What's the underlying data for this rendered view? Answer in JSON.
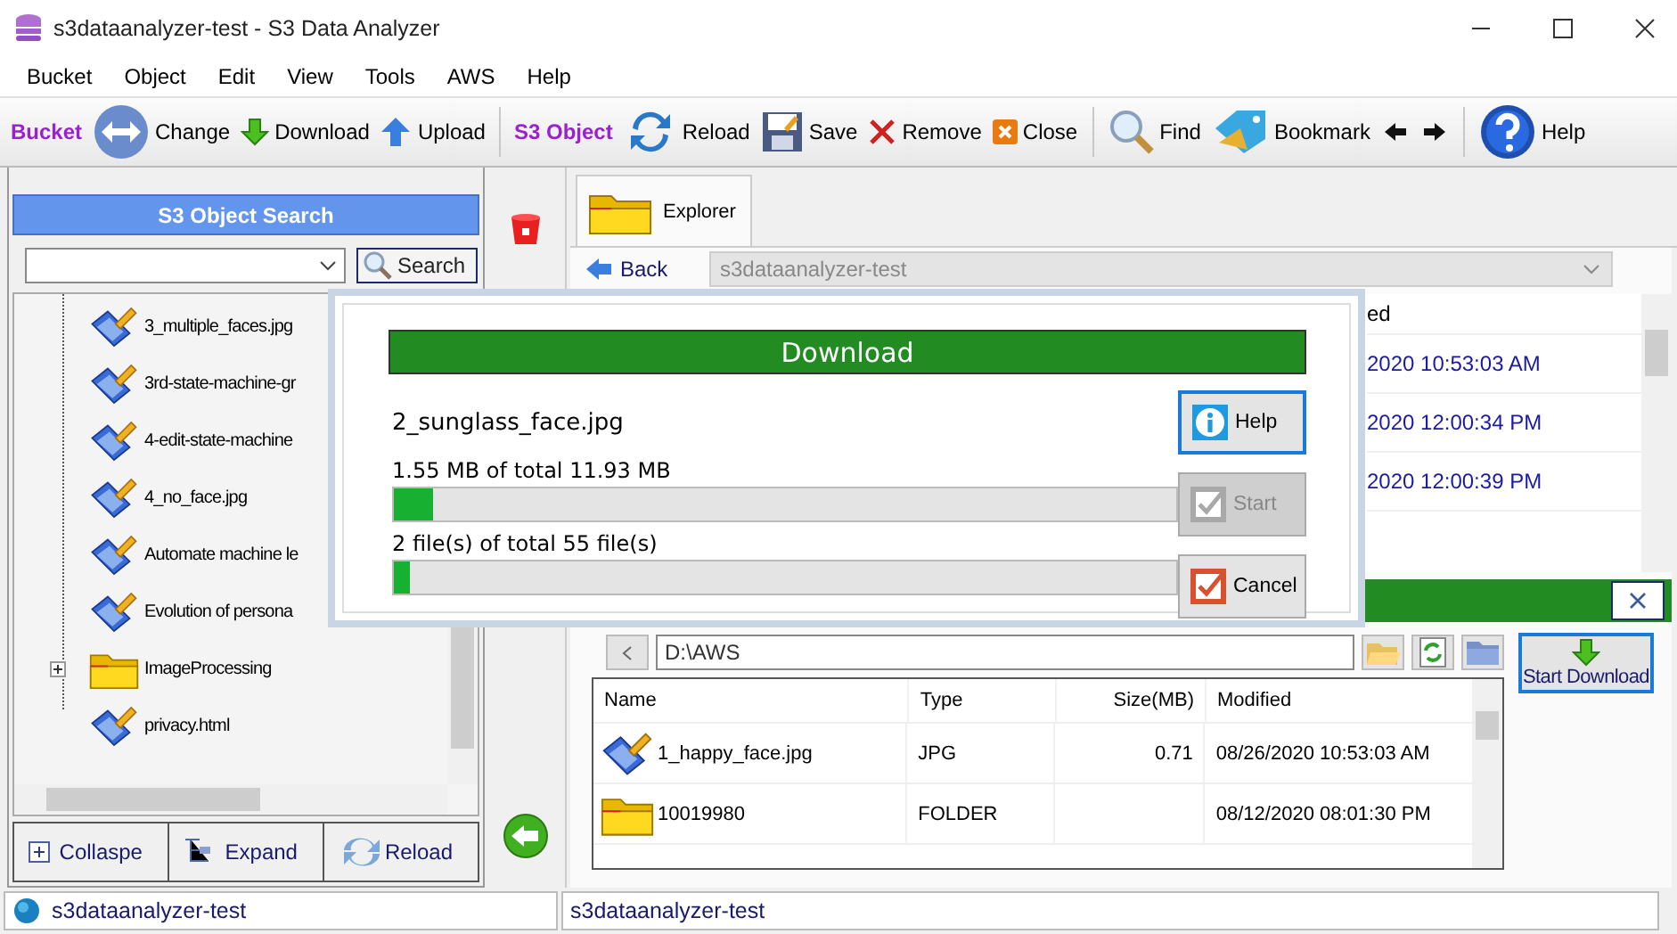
{
  "window": {
    "title": "s3dataanalyzer-test - S3 Data Analyzer"
  },
  "menu": [
    "Bucket",
    "Object",
    "Edit",
    "View",
    "Tools",
    "AWS",
    "Help"
  ],
  "toolbar": [
    {
      "kind": "group",
      "label": "Bucket"
    },
    {
      "kind": "button",
      "label": "Change"
    },
    {
      "kind": "button",
      "label": "Download"
    },
    {
      "kind": "button",
      "label": "Upload"
    },
    {
      "kind": "separator"
    },
    {
      "kind": "group",
      "label": "S3 Object"
    },
    {
      "kind": "button",
      "label": "Reload"
    },
    {
      "kind": "button",
      "label": "Save"
    },
    {
      "kind": "button",
      "label": "Remove"
    },
    {
      "kind": "button",
      "label": "Close"
    },
    {
      "kind": "separator"
    },
    {
      "kind": "button",
      "label": "Find"
    },
    {
      "kind": "button",
      "label": "Bookmark"
    },
    {
      "kind": "arrow"
    },
    {
      "kind": "arrow"
    },
    {
      "kind": "separator"
    },
    {
      "kind": "button",
      "label": "Help"
    }
  ],
  "search_panel": {
    "title": "S3 Object Search",
    "search_button": "Search"
  },
  "tree": [
    {
      "kind": "file",
      "label": "3_multiple_faces.jpg"
    },
    {
      "kind": "file",
      "label": "3rd-state-machine-gr"
    },
    {
      "kind": "file",
      "label": "4-edit-state-machine"
    },
    {
      "kind": "file",
      "label": "4_no_face.jpg"
    },
    {
      "kind": "file",
      "label": "Automate machine le"
    },
    {
      "kind": "file",
      "label": "Evolution of persona"
    },
    {
      "kind": "folder",
      "label": "ImageProcessing",
      "expanded": false
    },
    {
      "kind": "file",
      "label": "privacy.html"
    }
  ],
  "tree_buttons": [
    "Collaspe",
    "Expand",
    "Reload"
  ],
  "tabs": [
    {
      "label": "Explorer",
      "selected": true
    }
  ],
  "back_button": "Back",
  "address": "s3dataanalyzer-test",
  "object_list": {
    "header": "ed",
    "rows": [
      "2020 10:53:03 AM",
      "2020 12:00:34 PM",
      "2020 12:00:39 PM"
    ]
  },
  "download_panel": {
    "path": "D:\\AWS",
    "start_button": "Start Download",
    "columns": [
      "Name",
      "Type",
      "Size(MB)",
      "Modified"
    ],
    "rows": [
      {
        "kind": "file",
        "name": "1_happy_face.jpg",
        "type": "JPG",
        "size": "0.71",
        "modified": "08/26/2020 10:53:03 AM"
      },
      {
        "kind": "folder",
        "name": "10019980",
        "type": "FOLDER",
        "modified": "08/12/2020 08:01:30 PM"
      }
    ]
  },
  "dialog": {
    "title": "Download",
    "file": "2_sunglass_face.jpg",
    "progress": [
      {
        "label": "1.55 MB of total 11.93 MB",
        "level": 0.05
      },
      {
        "label": "2 file(s) of total 55 file(s)",
        "level": 0.02
      }
    ],
    "buttons": [
      {
        "label": "Help",
        "focused": true,
        "disabled": false
      },
      {
        "label": "Start",
        "focused": false,
        "disabled": true
      },
      {
        "label": "Cancel",
        "focused": false,
        "disabled": false
      }
    ]
  },
  "status_bar": [
    "s3dataanalyzer-test",
    "s3dataanalyzer-test"
  ]
}
